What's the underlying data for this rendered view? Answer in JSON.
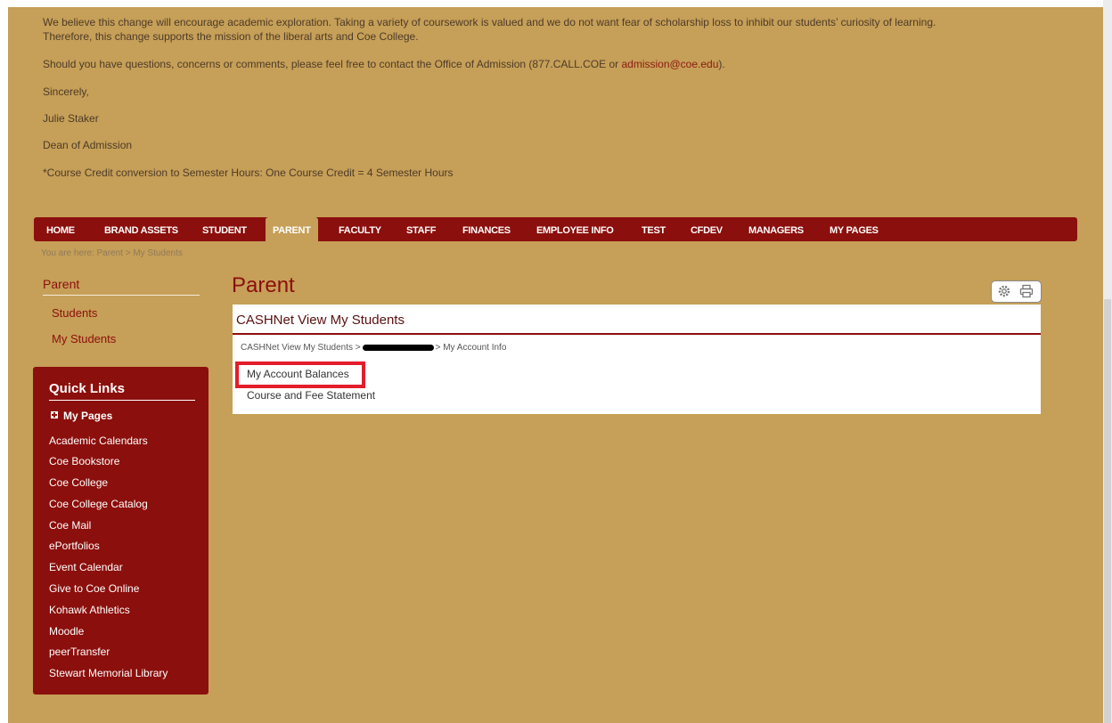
{
  "notice": {
    "para1": "We believe this change will encourage academic exploration. Taking a variety of coursework is valued and we do not want fear of scholarship loss to inhibit our students’ curiosity of learning.",
    "para1b": "Therefore, this change supports the mission of the liberal arts and Coe College.",
    "para2_pre": "Should you have questions, concerns or comments, please feel free to contact the Office of Admission (877.CALL.COE or ",
    "para2_link": "admission@coe.edu",
    "para2_post": ").",
    "closing": "Sincerely,",
    "signer": "Julie Staker",
    "signer_title": "Dean of Admission",
    "footnote": "*Course Credit conversion to Semester Hours: One Course Credit = 4 Semester Hours"
  },
  "nav": {
    "items": [
      "HOME",
      "BRAND ASSETS",
      "STUDENT",
      "PARENT",
      "FACULTY",
      "STAFF",
      "FINANCES",
      "EMPLOYEE INFO",
      "TEST",
      "CFDEV",
      "MANAGERS",
      "MY PAGES"
    ],
    "active": "PARENT"
  },
  "breadcrumb": "You are here:  Parent > My Students",
  "sidebar": {
    "title": "Parent",
    "links": [
      "Students",
      "My Students"
    ]
  },
  "quick_links": {
    "title": "Quick Links",
    "my_pages": "My Pages",
    "items": [
      "Academic Calendars",
      "Coe Bookstore",
      "Coe College",
      "Coe College Catalog",
      "Coe Mail",
      "ePortfolios",
      "Event Calendar",
      "Give to Coe Online",
      "Kohawk Athletics",
      "Moodle",
      "peerTransfer",
      "Stewart Memorial Library"
    ]
  },
  "main": {
    "title": "Parent",
    "panel_title": "CASHNet View My Students",
    "crumb_start": "CASHNet View My Students >",
    "crumb_end": "> My Account Info",
    "links": [
      "My Account Balances",
      "Course and Fee Statement"
    ]
  },
  "icons": {
    "settings": "gear-icon",
    "print": "printer-icon"
  },
  "colors": {
    "background": "#c69f58",
    "nav": "#8b0f0c",
    "highlight": "#e31d2b"
  }
}
